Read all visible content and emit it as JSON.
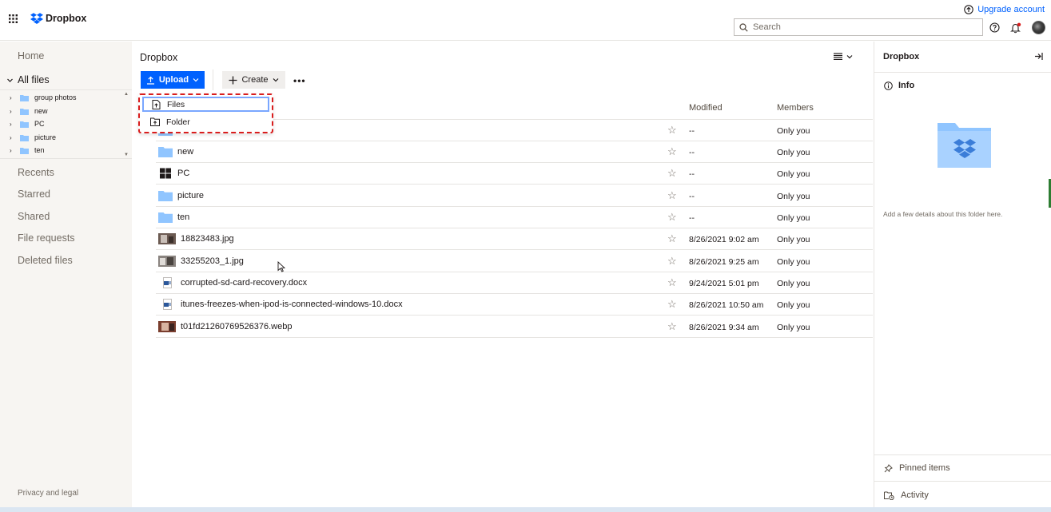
{
  "header": {
    "brand": "Dropbox",
    "upgrade_label": "Upgrade account",
    "search_placeholder": "Search"
  },
  "sidebar": {
    "home": "Home",
    "all_files": "All files",
    "tree": [
      "group photos",
      "new",
      "PC",
      "picture",
      "ten"
    ],
    "recents": "Recents",
    "starred": "Starred",
    "shared": "Shared",
    "file_requests": "File requests",
    "deleted_files": "Deleted files",
    "privacy": "Privacy and legal"
  },
  "main": {
    "breadcrumb": "Dropbox",
    "upload_label": "Upload",
    "create_label": "Create",
    "more_label": "•••",
    "columns": {
      "modified": "Modified",
      "members": "Members"
    },
    "upload_menu": {
      "files": "Files",
      "folder": "Folder"
    },
    "rows": [
      {
        "name": "",
        "modified": "--",
        "members": "Only you",
        "icon": "folder-icon"
      },
      {
        "name": "new",
        "modified": "--",
        "members": "Only you",
        "icon": "folder-icon"
      },
      {
        "name": "PC",
        "modified": "--",
        "members": "Only you",
        "icon": "windows-icon"
      },
      {
        "name": "picture",
        "modified": "--",
        "members": "Only you",
        "icon": "folder-icon"
      },
      {
        "name": "ten",
        "modified": "--",
        "members": "Only you",
        "icon": "folder-icon"
      },
      {
        "name": "18823483.jpg",
        "modified": "8/26/2021 9:02 am",
        "members": "Only you",
        "icon": "image-thumb"
      },
      {
        "name": "33255203_1.jpg",
        "modified": "8/26/2021 9:25 am",
        "members": "Only you",
        "icon": "image-thumb"
      },
      {
        "name": "corrupted-sd-card-recovery.docx",
        "modified": "9/24/2021 5:01 pm",
        "members": "Only you",
        "icon": "word-doc-icon"
      },
      {
        "name": "itunes-freezes-when-ipod-is-connected-windows-10.docx",
        "modified": "8/26/2021 10:50 am",
        "members": "Only you",
        "icon": "word-doc-icon"
      },
      {
        "name": "t01fd21260769526376.webp",
        "modified": "8/26/2021 9:34 am",
        "members": "Only you",
        "icon": "image-thumb"
      }
    ]
  },
  "right_panel": {
    "title": "Dropbox",
    "info": "Info",
    "hint": "Add a few details about this folder here.",
    "pinned": "Pinned items",
    "activity": "Activity"
  },
  "colors": {
    "accent": "#0061fe",
    "folder": "#90c5ff",
    "highlight": "#d91d1d"
  }
}
